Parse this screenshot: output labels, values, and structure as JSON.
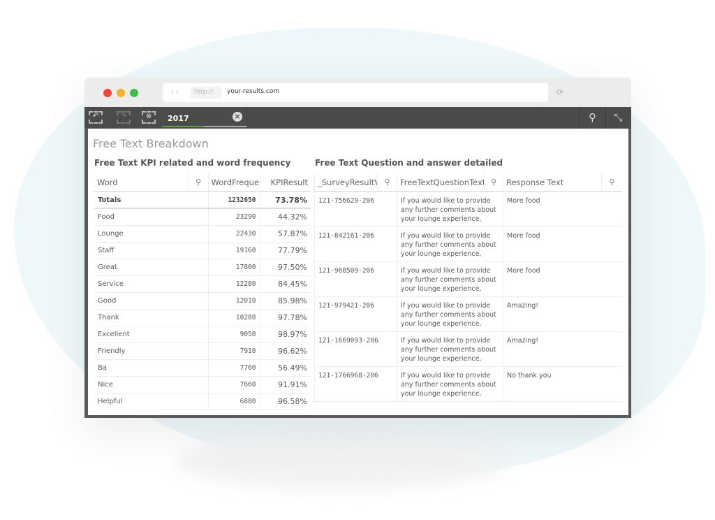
{
  "browser": {
    "url_protocol": "http://",
    "url_host": "your-results.com",
    "colors": {
      "close": "#f0473e",
      "minimize": "#f5b12d",
      "maximize": "#3dbd4a"
    }
  },
  "toolbar": {
    "selection_value": "2017",
    "icons": [
      "smart-back-icon",
      "forward-icon",
      "clear-selections-icon",
      "search-icon",
      "exit-fullscreen-icon"
    ]
  },
  "page": {
    "title": "Free Text Breakdown"
  },
  "left_table": {
    "title": "Free Text KPI related and word frequency",
    "columns": [
      "Word",
      "WordFrequency",
      "KPIResult"
    ],
    "totals": {
      "label": "Totals",
      "frequency": "1232650",
      "kpi": "73.78%"
    },
    "rows": [
      {
        "word": "Food",
        "frequency": "23290",
        "kpi": "44.32%"
      },
      {
        "word": "Lounge",
        "frequency": "22430",
        "kpi": "57.87%"
      },
      {
        "word": "Staff",
        "frequency": "19160",
        "kpi": "77.79%"
      },
      {
        "word": "Great",
        "frequency": "17800",
        "kpi": "97.50%"
      },
      {
        "word": "Service",
        "frequency": "12280",
        "kpi": "84.45%"
      },
      {
        "word": "Good",
        "frequency": "12010",
        "kpi": "85.98%"
      },
      {
        "word": "Thank",
        "frequency": "10280",
        "kpi": "97.78%"
      },
      {
        "word": "Excellent",
        "frequency": "9050",
        "kpi": "98.97%"
      },
      {
        "word": "Friendly",
        "frequency": "7910",
        "kpi": "96.62%"
      },
      {
        "word": "Ba",
        "frequency": "7760",
        "kpi": "56.49%"
      },
      {
        "word": "Nice",
        "frequency": "7660",
        "kpi": "91.91%"
      },
      {
        "word": "Helpful",
        "frequency": "6880",
        "kpi": "96.58%"
      }
    ]
  },
  "right_table": {
    "title": "Free Text Question and answer detailed",
    "columns": [
      "_SurveyResultV",
      "FreeTextQuestionText",
      "Response Text"
    ],
    "rows": [
      {
        "id": "121-756629-206",
        "question": "If you would like to provide any further comments about your lounge experience,",
        "response": "More food"
      },
      {
        "id": "121-842161-206",
        "question": "If you would like to provide any further comments about your lounge experience,",
        "response": "More food"
      },
      {
        "id": "121-968509-206",
        "question": "If you would like to provide any further comments about your lounge experience,",
        "response": "More food"
      },
      {
        "id": "121-979421-206",
        "question": "If you would like to provide any further comments about your lounge experience,",
        "response": "Amazing!"
      },
      {
        "id": "121-1669093-206",
        "question": "If you would like to provide any further comments about your lounge experience,",
        "response": "Amazing!"
      },
      {
        "id": "121-1766968-206",
        "question": "If you would like to provide any further comments about your lounge experience,",
        "response": "No thank you"
      }
    ]
  }
}
